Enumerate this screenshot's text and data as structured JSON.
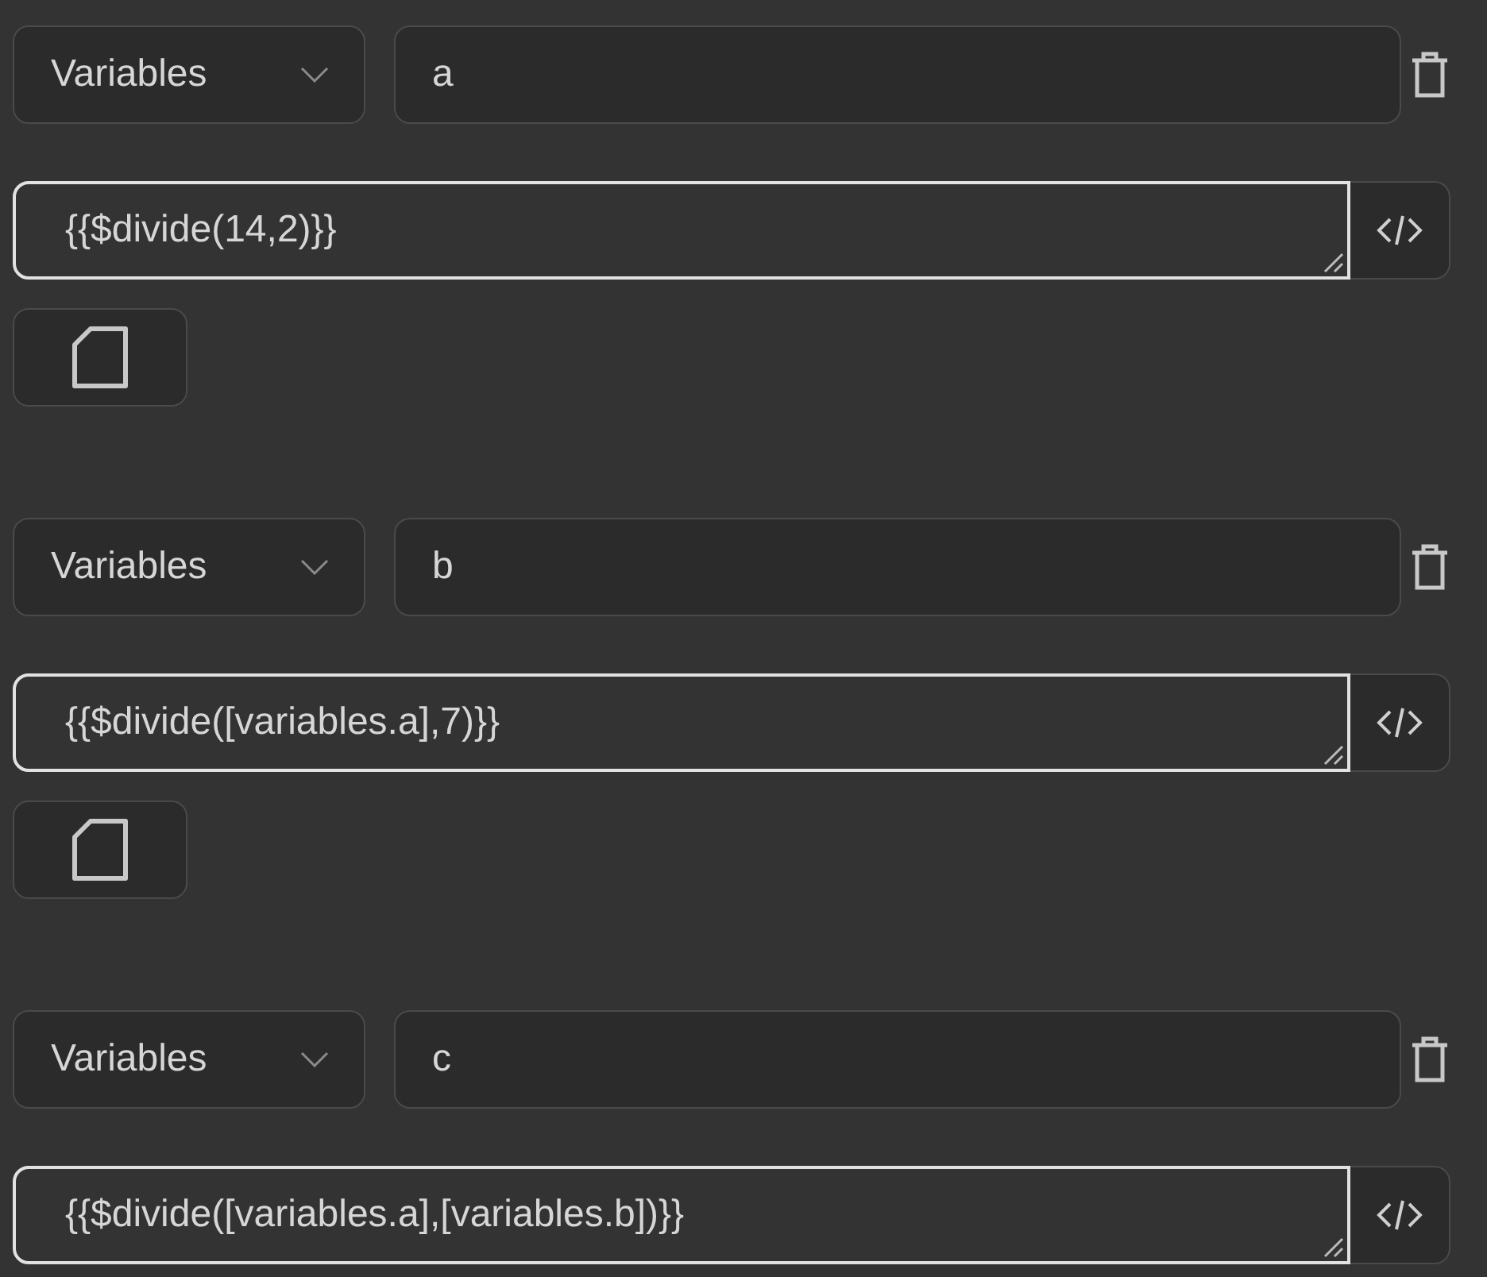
{
  "variables": [
    {
      "source": "Variables",
      "name": "a",
      "expression": "{{$divide(14,2)}}"
    },
    {
      "source": "Variables",
      "name": "b",
      "expression": "{{$divide([variables.a],7)}}"
    },
    {
      "source": "Variables",
      "name": "c",
      "expression": "{{$divide([variables.a],[variables.b])}}"
    }
  ]
}
